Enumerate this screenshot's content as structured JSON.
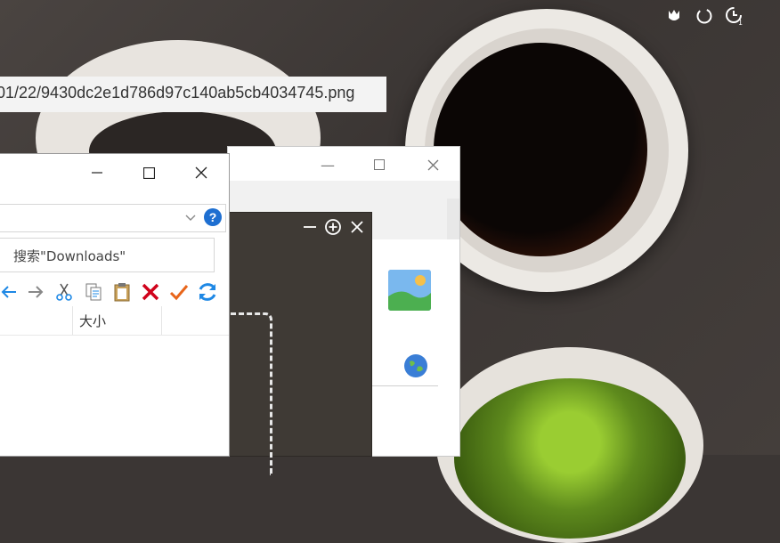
{
  "path_bar": {
    "text": "01/22/9430dc2e1d786d97c140ab5cb4034745.png"
  },
  "tray_icons": [
    "tulip-icon",
    "focus-icon",
    "clock-icon"
  ],
  "explorer_window": {
    "search_placeholder": "搜索\"Downloads\"",
    "help_label": "?",
    "column_headers": {
      "size": "大小"
    },
    "toolbar_icons": [
      "back-arrow-icon",
      "forward-arrow-icon",
      "cut-icon",
      "copy-icon",
      "paste-icon",
      "delete-icon",
      "check-icon",
      "refresh-icon"
    ]
  },
  "colors": {
    "help_blue": "#1e6fd1",
    "delete_red": "#d0021b",
    "check_orange": "#e8651a",
    "refresh_blue": "#1e88e5",
    "dark_panel": "#3f3a35"
  }
}
